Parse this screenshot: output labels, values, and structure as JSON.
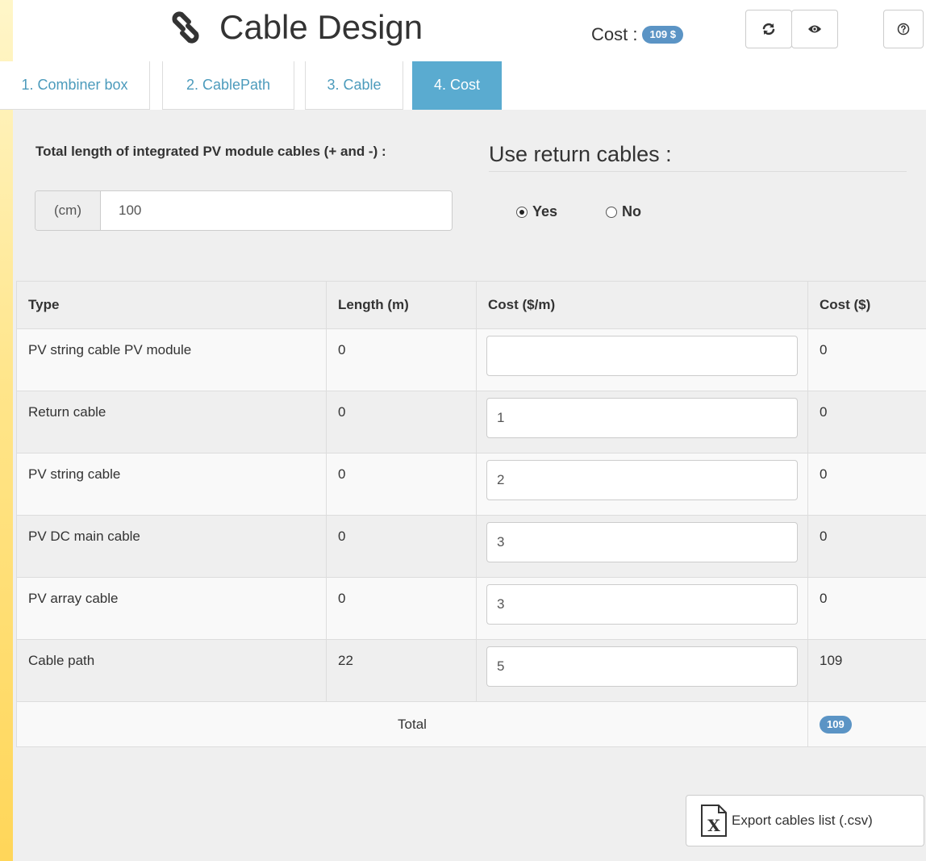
{
  "header": {
    "title": "Cable Design",
    "cost_label": "Cost :",
    "cost_badge": "109 $",
    "buttons": {
      "refresh_icon": "refresh-icon",
      "view_icon": "eye-icon",
      "help_icon": "help-icon"
    }
  },
  "tabs": [
    {
      "label": "1. Combiner box",
      "active": false
    },
    {
      "label": "2. CablePath",
      "active": false
    },
    {
      "label": "3. Cable",
      "active": false
    },
    {
      "label": "4. Cost",
      "active": true
    }
  ],
  "pv_length": {
    "label": "Total length of integrated PV module cables (+ and -) :",
    "unit": "(cm)",
    "value": "100"
  },
  "return_cables": {
    "heading": "Use return cables :",
    "options": [
      {
        "label": "Yes",
        "checked": true
      },
      {
        "label": "No",
        "checked": false
      }
    ]
  },
  "table": {
    "headers": [
      "Type",
      "Length (m)",
      "Cost ($/m)",
      "Cost ($)"
    ],
    "rows": [
      {
        "type": "PV string cable PV module",
        "length": "0",
        "cost_per_m": "",
        "cost": "0"
      },
      {
        "type": "Return cable",
        "length": "0",
        "cost_per_m": "1",
        "cost": "0"
      },
      {
        "type": "PV string cable",
        "length": "0",
        "cost_per_m": "2",
        "cost": "0"
      },
      {
        "type": "PV DC main cable",
        "length": "0",
        "cost_per_m": "3",
        "cost": "0"
      },
      {
        "type": "PV array cable",
        "length": "0",
        "cost_per_m": "3",
        "cost": "0"
      },
      {
        "type": "Cable path",
        "length": "22",
        "cost_per_m": "5",
        "cost": "109"
      }
    ],
    "total_label": "Total",
    "total_value": "109"
  },
  "export": {
    "label": "Export cables list (.csv)",
    "icon": "excel-file-icon"
  },
  "colors": {
    "accent_tab": "#5aabd0",
    "badge": "#5b94c5",
    "link_text": "#4c9bbc",
    "side_bar": "#ffd659"
  }
}
